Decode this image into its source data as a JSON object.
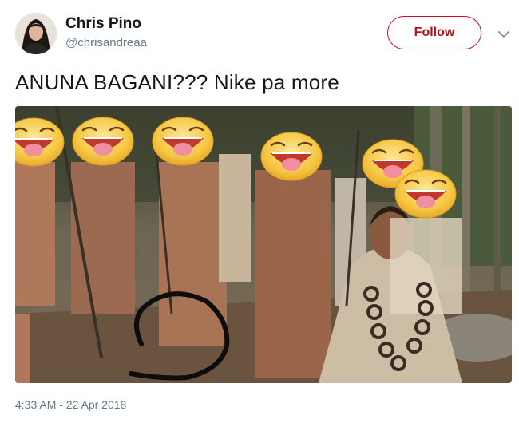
{
  "author": {
    "name": "Chris Pino",
    "handle": "@chrisandreaa",
    "avatar_icon": "profile-photo"
  },
  "actions": {
    "follow_label": "Follow",
    "menu_icon": "chevron-down-icon"
  },
  "tweet": {
    "text": "ANUNA BAGANI??? Nike pa more",
    "timestamp": "4:33 AM - 22 Apr 2018"
  },
  "media": {
    "description_icon": "photo",
    "overlay_icons": [
      "laughing-emoji-icon",
      "laughing-emoji-icon",
      "laughing-emoji-icon",
      "laughing-emoji-icon",
      "laughing-emoji-icon",
      "laughing-emoji-icon"
    ],
    "annotation_icon": "hand-drawn-swoosh-icon"
  },
  "colors": {
    "follow_border": "#c8102e",
    "follow_text": "#b31217",
    "secondary_text": "#657786",
    "emoji_yellow": "#f6c743"
  }
}
